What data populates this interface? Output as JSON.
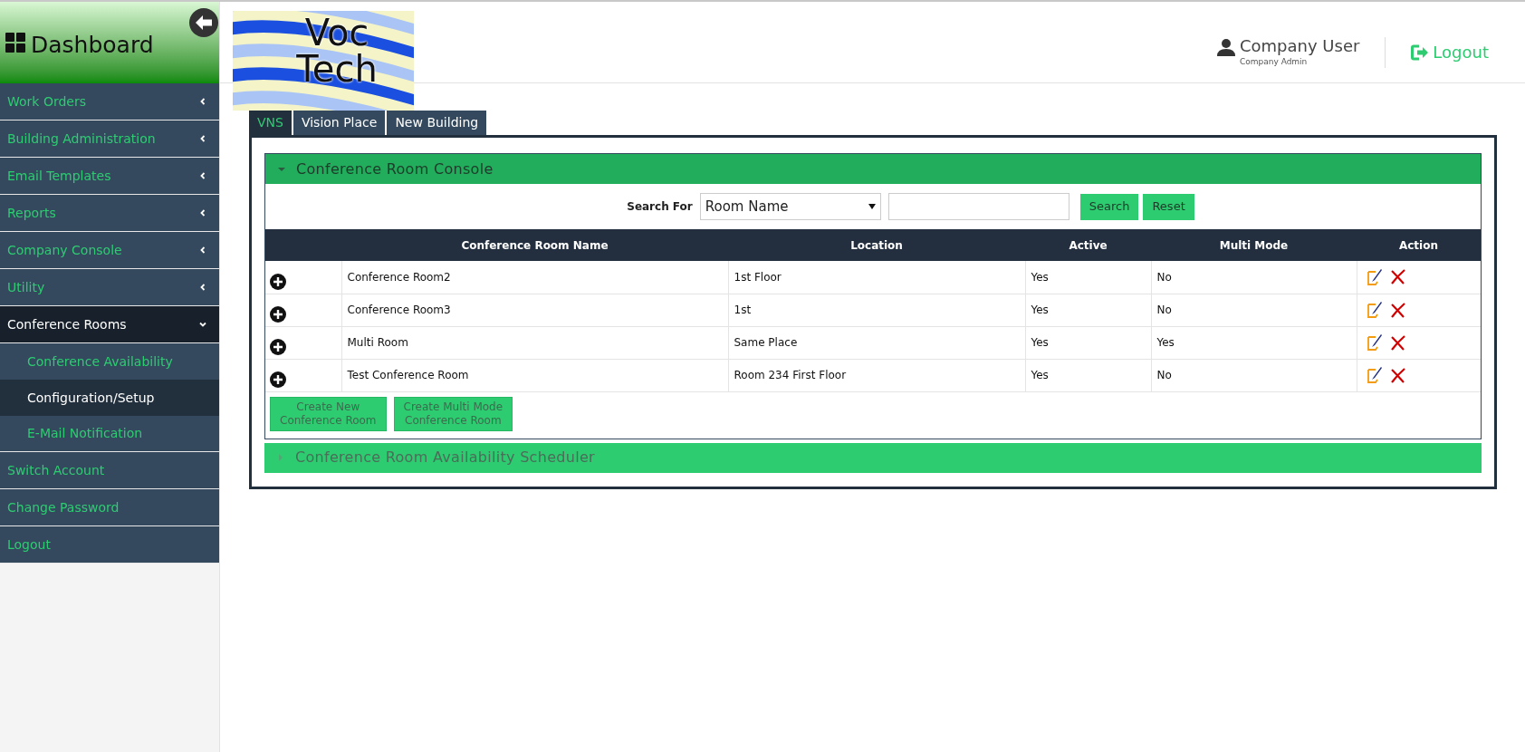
{
  "sidebar": {
    "title": "Dashboard",
    "items": [
      {
        "label": "Work Orders",
        "kind": "group",
        "expanded": false
      },
      {
        "label": "Building Administration",
        "kind": "group",
        "expanded": false
      },
      {
        "label": "Email Templates",
        "kind": "group",
        "expanded": false
      },
      {
        "label": "Reports",
        "kind": "group",
        "expanded": false
      },
      {
        "label": "Company Console",
        "kind": "group",
        "expanded": false
      },
      {
        "label": "Utility",
        "kind": "group",
        "expanded": false
      },
      {
        "label": "Conference Rooms",
        "kind": "group",
        "expanded": true,
        "children": [
          {
            "label": "Conference Availability",
            "selected": false
          },
          {
            "label": "Configuration/Setup",
            "selected": true
          },
          {
            "label": "E-Mail Notification",
            "selected": false
          }
        ]
      },
      {
        "label": "Switch Account",
        "kind": "link"
      },
      {
        "label": "Change Password",
        "kind": "link"
      },
      {
        "label": "Logout",
        "kind": "link"
      }
    ]
  },
  "logo": {
    "lines": [
      "Voc",
      "Tech"
    ]
  },
  "user": {
    "name": "Company User",
    "role": "Company Admin",
    "logout": "Logout"
  },
  "tabs": [
    {
      "label": "VNS",
      "selected": true
    },
    {
      "label": "Vision Place",
      "selected": false
    },
    {
      "label": "New Building",
      "selected": false
    }
  ],
  "panels": [
    {
      "title": "Conference Room Console",
      "expanded": true
    },
    {
      "title": "Conference Room Availability Scheduler",
      "expanded": false
    }
  ],
  "search": {
    "label": "Search For",
    "field": "Room Name",
    "buttons": [
      "Search",
      "Reset"
    ]
  },
  "table": {
    "columns": [
      "Conference Room Name",
      "Location",
      "Active",
      "Multi Mode",
      "Action"
    ],
    "rows": [
      [
        "Conference Room2",
        "1st Floor",
        "Yes",
        "No"
      ],
      [
        "Conference Room3",
        "1st",
        "Yes",
        "No"
      ],
      [
        "Multi Room",
        "Same Place",
        "Yes",
        "Yes"
      ],
      [
        "Test Conference Room",
        "Room 234 First Floor",
        "Yes",
        "No"
      ]
    ]
  },
  "create_buttons": [
    [
      "Create New",
      "Conference Room"
    ],
    [
      "Create Multi Mode",
      "Conference Room"
    ]
  ]
}
